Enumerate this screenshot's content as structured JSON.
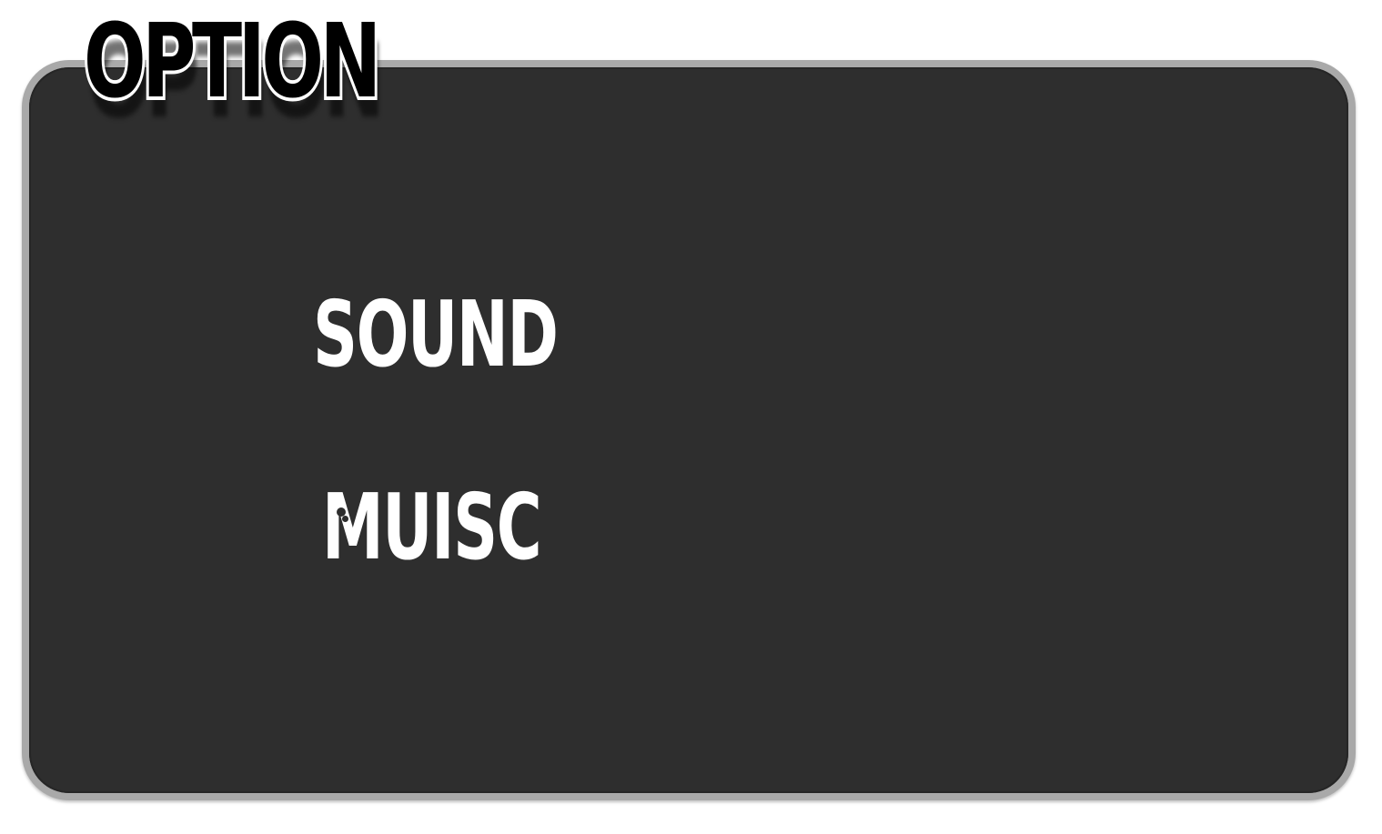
{
  "screen": {
    "title": "OPTION"
  },
  "menu": {
    "items": [
      {
        "label": "SOUND"
      },
      {
        "label": "MUISC"
      }
    ]
  },
  "colors": {
    "panel_fill": "#2e2e2e",
    "panel_border": "#a9a9a9",
    "text": "#ffffff",
    "title_fill": "#000000",
    "background": "#ffffff"
  }
}
